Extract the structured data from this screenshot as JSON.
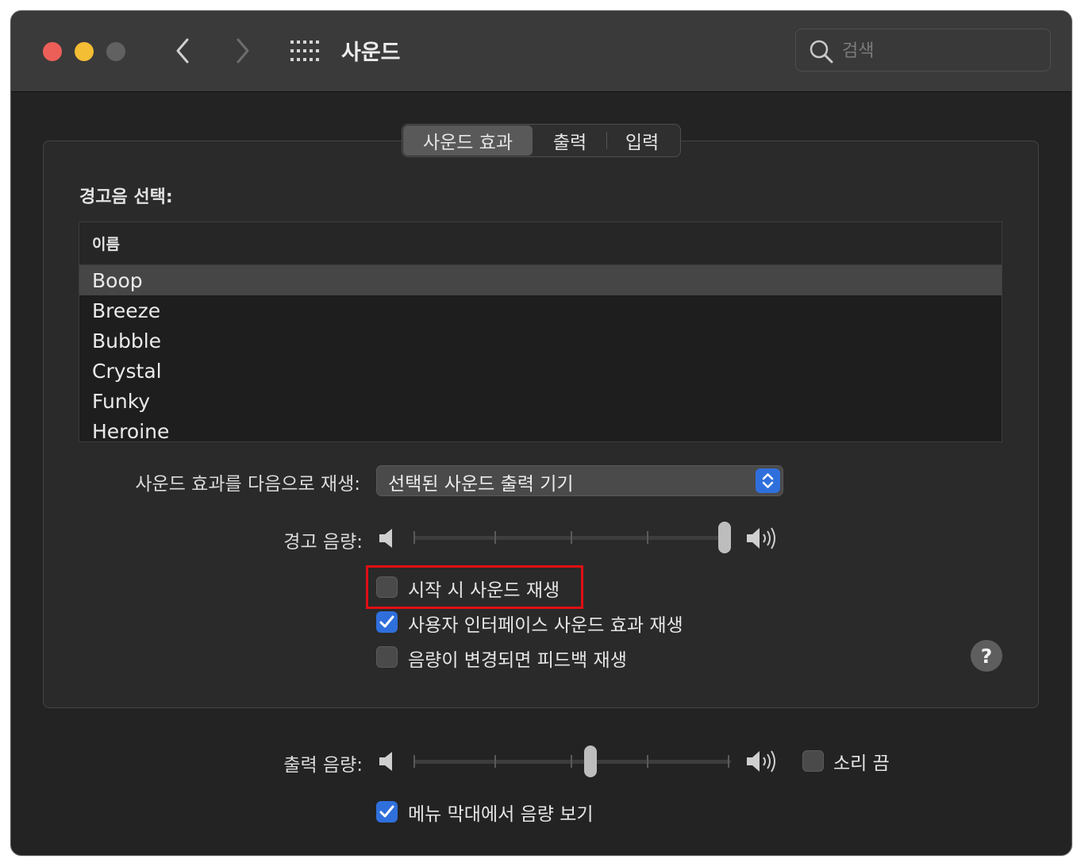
{
  "window": {
    "title": "사운드",
    "search_placeholder": "검색"
  },
  "tabs": [
    {
      "label": "사운드 효과",
      "active": true
    },
    {
      "label": "출력",
      "active": false
    },
    {
      "label": "입력",
      "active": false
    }
  ],
  "alert": {
    "section_label": "경고음 선택:",
    "column_header": "이름",
    "sounds": [
      "Boop",
      "Breeze",
      "Bubble",
      "Crystal",
      "Funky",
      "Heroine"
    ],
    "selected": "Boop"
  },
  "play_through": {
    "label": "사운드 효과를 다음으로 재생:",
    "value": "선택된 사운드 출력 기기"
  },
  "alert_volume": {
    "label": "경고 음량:",
    "level": 1.0
  },
  "checkboxes": {
    "startup": {
      "label": "시작 시 사운드 재생",
      "checked": false
    },
    "ui_effects": {
      "label": "사용자 인터페이스 사운드 효과 재생",
      "checked": true
    },
    "volume_feedback": {
      "label": "음량이 변경되면 피드백 재생",
      "checked": false
    }
  },
  "help": {
    "label": "?"
  },
  "output_volume": {
    "label": "출력 음량:",
    "level": 0.56,
    "mute_label": "소리 끔",
    "mute_checked": false
  },
  "menu_bar_volume": {
    "label": "메뉴 막대에서 음량 보기",
    "checked": true
  },
  "colors": {
    "accent": "#2f6fdc",
    "highlight_box": "#e10f14"
  }
}
